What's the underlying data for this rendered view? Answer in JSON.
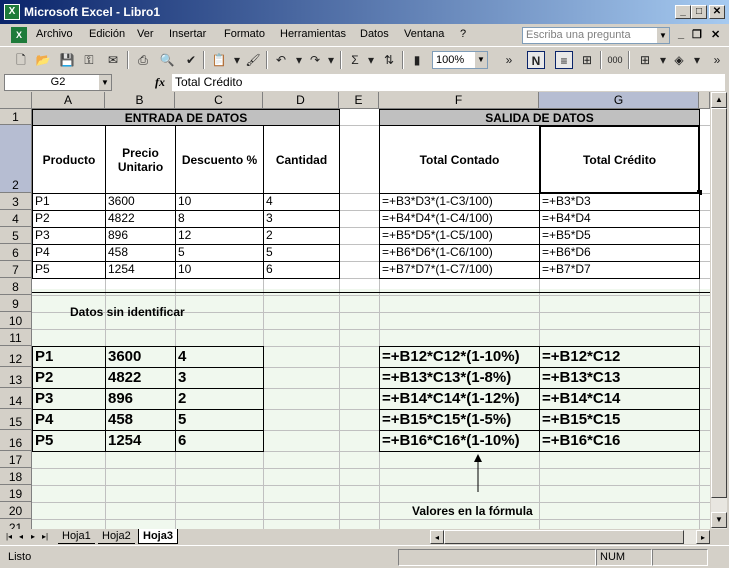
{
  "window": {
    "title": "Microsoft Excel - Libro1"
  },
  "menu": {
    "items": [
      "Archivo",
      "Edición",
      "Ver",
      "Insertar",
      "Formato",
      "Herramientas",
      "Datos",
      "Ventana",
      "?"
    ],
    "ask_placeholder": "Escriba una pregunta"
  },
  "toolbar": {
    "zoom": "100%",
    "bold_label": "N",
    "thousands_label": "000"
  },
  "formula_bar": {
    "name_box": "G2",
    "fx": "fx",
    "formula": "Total Crédito"
  },
  "columns": [
    "A",
    "B",
    "C",
    "D",
    "E",
    "F",
    "G"
  ],
  "rows": [
    "1",
    "2",
    "3",
    "4",
    "5",
    "6",
    "7",
    "8",
    "9",
    "10",
    "11",
    "12",
    "13",
    "14",
    "15",
    "16",
    "17",
    "18",
    "19",
    "20",
    "21"
  ],
  "sheet": {
    "entrada_title": "ENTRADA DE DATOS",
    "salida_title": "SALIDA DE DATOS",
    "labels": {
      "producto": "Producto",
      "precio": "Precio Unitario",
      "descuento": "Descuento %",
      "cantidad": "Cantidad",
      "total_contado": "Total Contado",
      "total_credito": "Total Crédito"
    },
    "data_rows": [
      {
        "a": "P1",
        "b": "3600",
        "c": "10",
        "d": "4",
        "f": "=+B3*D3*(1-C3/100)",
        "g": "=+B3*D3"
      },
      {
        "a": "P2",
        "b": "4822",
        "c": "8",
        "d": "3",
        "f": "=+B4*D4*(1-C4/100)",
        "g": "=+B4*D4"
      },
      {
        "a": "P3",
        "b": "896",
        "c": "12",
        "d": "2",
        "f": "=+B5*D5*(1-C5/100)",
        "g": "=+B5*D5"
      },
      {
        "a": "P4",
        "b": "458",
        "c": "5",
        "d": "5",
        "f": "=+B6*D6*(1-C6/100)",
        "g": "=+B6*D6"
      },
      {
        "a": "P5",
        "b": "1254",
        "c": "10",
        "d": "6",
        "f": "=+B7*D7*(1-C7/100)",
        "g": "=+B7*D7"
      }
    ],
    "note_unidentified": "Datos sin identificar",
    "big_rows": [
      {
        "a": "P1",
        "b": "3600",
        "c": "4",
        "f": "=+B12*C12*(1-10%)",
        "g": "=+B12*C12"
      },
      {
        "a": "P2",
        "b": "4822",
        "c": "3",
        "f": "=+B13*C13*(1-8%)",
        "g": "=+B13*C13"
      },
      {
        "a": "P3",
        "b": "896",
        "c": "2",
        "f": "=+B14*C14*(1-12%)",
        "g": "=+B14*C14"
      },
      {
        "a": "P4",
        "b": "458",
        "c": "5",
        "f": "=+B15*C15*(1-5%)",
        "g": "=+B15*C15"
      },
      {
        "a": "P5",
        "b": "1254",
        "c": "6",
        "f": "=+B16*C16*(1-10%)",
        "g": "=+B16*C16"
      }
    ],
    "note_values": "Valores en la fórmula"
  },
  "tabs": [
    "Hoja1",
    "Hoja2",
    "Hoja3"
  ],
  "active_tab": "Hoja3",
  "status": {
    "text": "Listo",
    "num": "NUM"
  }
}
